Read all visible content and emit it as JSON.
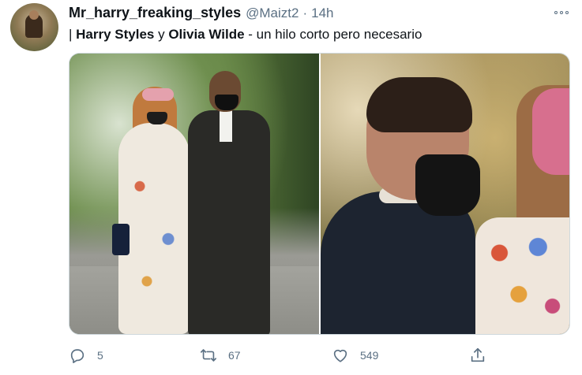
{
  "tweet": {
    "author": {
      "display_name": "Mr_harry_freaking_styles",
      "handle": "@Maizt2",
      "separator": "·",
      "time": "14h"
    },
    "text": {
      "prefix": "| ",
      "bold1": "Harry Styles",
      "middle": " y ",
      "bold2": "Olivia Wilde",
      "suffix": " - un hilo corto pero necesario"
    },
    "media": {
      "photos": [
        "left",
        "right"
      ]
    },
    "actions": {
      "replies": "5",
      "retweets": "67",
      "likes": "549"
    }
  },
  "icons": {
    "more": "more-icon",
    "reply": "reply-icon",
    "retweet": "retweet-icon",
    "like": "heart-icon",
    "share": "share-icon"
  },
  "colors": {
    "text_primary": "#0f1419",
    "text_secondary": "#5b7083",
    "border": "#cfd9de"
  }
}
